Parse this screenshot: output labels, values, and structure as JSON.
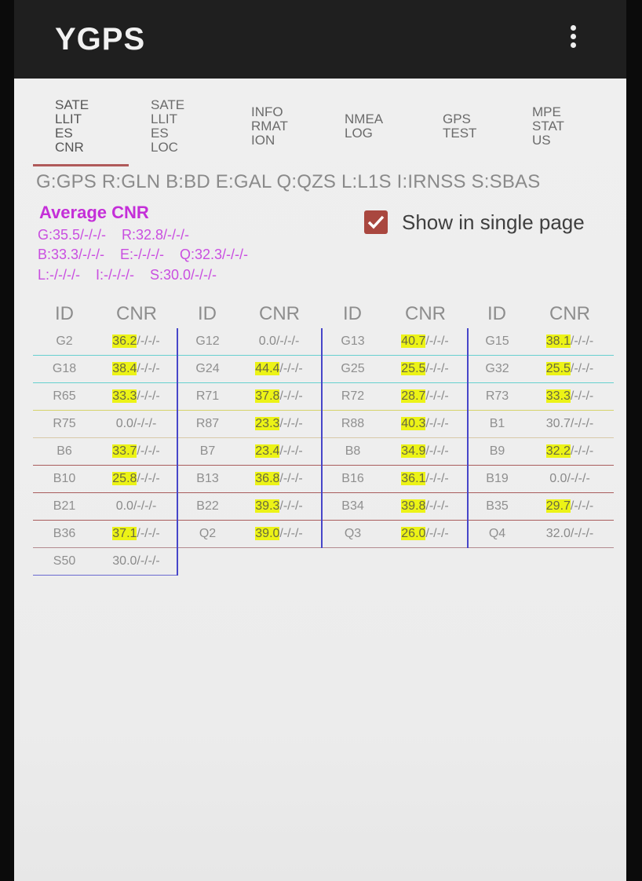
{
  "app": {
    "title": "YGPS",
    "menu_icon": "more-vert-icon"
  },
  "tabs": [
    {
      "label": "SATE\nLLIT\nES\nCNR",
      "active": true
    },
    {
      "label": "SATE\nLLIT\nES\nLOC",
      "active": false
    },
    {
      "label": "INFO\nRMAT\nION",
      "active": false
    },
    {
      "label": "NMEA\nLOG",
      "active": false
    },
    {
      "label": "GPS\nTEST",
      "active": false
    },
    {
      "label": "MPE\nSTAT\nUS",
      "active": false
    }
  ],
  "legend": "G:GPS R:GLN B:BD E:GAL Q:QZS L:L1S I:IRNSS S:SBAS",
  "average": {
    "title": "Average CNR",
    "line1": "G:35.5/-/-/-    R:32.8/-/-/-",
    "line2": "B:33.3/-/-/-    E:-/-/-/-    Q:32.3/-/-/-",
    "line3": "L:-/-/-/-    I:-/-/-/-    S:30.0/-/-/-"
  },
  "single_page": {
    "label": "Show in single page",
    "checked": true
  },
  "table": {
    "headers": [
      "ID",
      "CNR",
      "ID",
      "CNR",
      "ID",
      "CNR",
      "ID",
      "CNR"
    ],
    "rows": [
      [
        [
          "G2",
          "36.2",
          "/-/-/-",
          true
        ],
        [
          "G12",
          "0.0",
          "/-/-/-",
          false
        ],
        [
          "G13",
          "40.7",
          "/-/-/-",
          true
        ],
        [
          "G15",
          "38.1",
          "/-/-/-",
          true
        ]
      ],
      [
        [
          "G18",
          "38.4",
          "/-/-/-",
          true
        ],
        [
          "G24",
          "44.4",
          "/-/-/-",
          true
        ],
        [
          "G25",
          "25.5",
          "/-/-/-",
          true
        ],
        [
          "G32",
          "25.5",
          "/-/-/-",
          true
        ]
      ],
      [
        [
          "R65",
          "33.3",
          "/-/-/-",
          true
        ],
        [
          "R71",
          "37.8",
          "/-/-/-",
          true
        ],
        [
          "R72",
          "28.7",
          "/-/-/-",
          true
        ],
        [
          "R73",
          "33.3",
          "/-/-/-",
          true
        ]
      ],
      [
        [
          "R75",
          "0.0",
          "/-/-/-",
          false
        ],
        [
          "R87",
          "23.3",
          "/-/-/-",
          true
        ],
        [
          "R88",
          "40.3",
          "/-/-/-",
          true
        ],
        [
          "B1",
          "30.7",
          "/-/-/-",
          false
        ]
      ],
      [
        [
          "B6",
          "33.7",
          "/-/-/-",
          true
        ],
        [
          "B7",
          "23.4",
          "/-/-/-",
          true
        ],
        [
          "B8",
          "34.9",
          "/-/-/-",
          true
        ],
        [
          "B9",
          "32.2",
          "/-/-/-",
          true
        ]
      ],
      [
        [
          "B10",
          "25.8",
          "/-/-/-",
          true
        ],
        [
          "B13",
          "36.8",
          "/-/-/-",
          true
        ],
        [
          "B16",
          "36.1",
          "/-/-/-",
          true
        ],
        [
          "B19",
          "0.0",
          "/-/-/-",
          false
        ]
      ],
      [
        [
          "B21",
          "0.0",
          "/-/-/-",
          false
        ],
        [
          "B22",
          "39.3",
          "/-/-/-",
          true
        ],
        [
          "B34",
          "39.8",
          "/-/-/-",
          true
        ],
        [
          "B35",
          "29.7",
          "/-/-/-",
          true
        ]
      ],
      [
        [
          "B36",
          "37.1",
          "/-/-/-",
          true
        ],
        [
          "Q2",
          "39.0",
          "/-/-/-",
          true
        ],
        [
          "Q3",
          "26.0",
          "/-/-/-",
          true
        ],
        [
          "Q4",
          "32.0",
          "/-/-/-",
          false
        ]
      ],
      [
        [
          "S50",
          "30.0",
          "/-/-/-",
          false
        ]
      ]
    ]
  },
  "colors": {
    "highlight": "#ecf316",
    "average_text": "#c42fd8",
    "checkbox": "#a9473f",
    "group_divider": "#4746c9"
  }
}
